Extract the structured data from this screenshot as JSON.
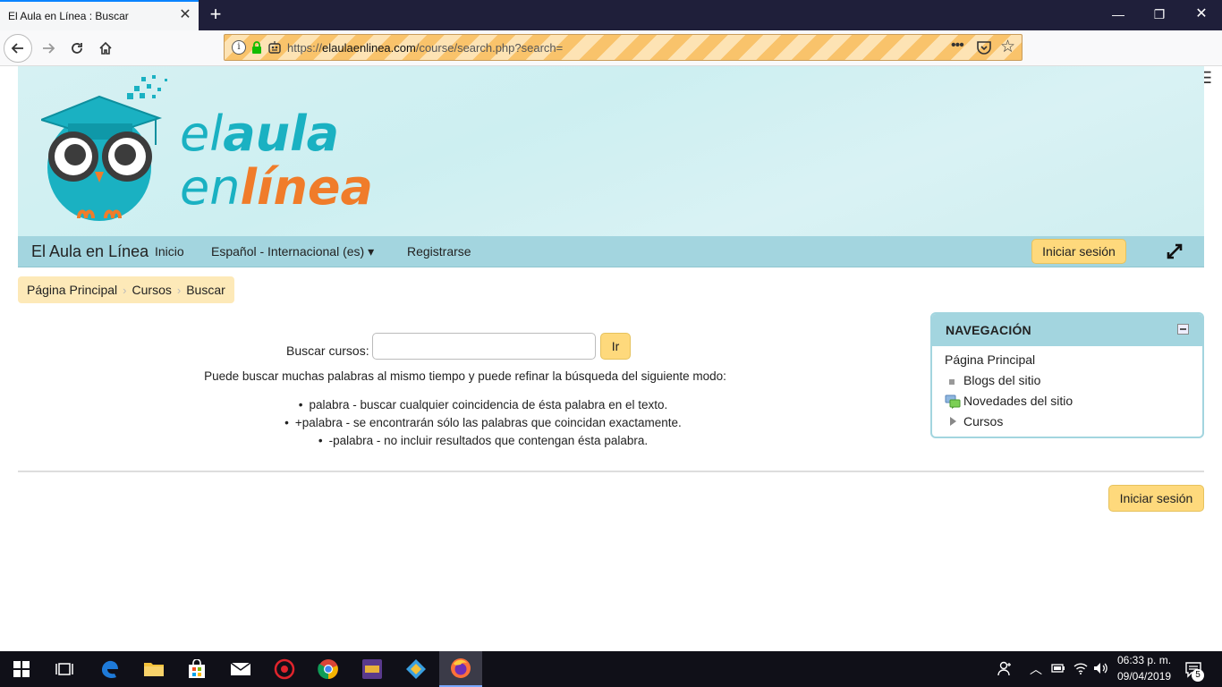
{
  "browser": {
    "tab_title": "El Aula en Línea : Buscar",
    "tab_close": "✕",
    "new_tab": "+",
    "url_scheme": "https://",
    "url_domain": "elaulaenlinea.com",
    "url_path": "/course/search.php?search=",
    "url_more": "•••",
    "win_min": "—",
    "win_max": "❐",
    "win_close": "✕",
    "menu": "☰",
    "accent": "#0a84ff"
  },
  "logo": {
    "line1_a": "el",
    "line1_b": "aula",
    "line2_a": "en",
    "line2_b": "línea",
    "teal": "#1ab1c2",
    "orange": "#f07c2a"
  },
  "site_nav": {
    "site_name": "El Aula en Línea",
    "home": "Inicio",
    "language": "Español - Internacional (es)",
    "register": "Registrarse",
    "login": "Iniciar sesión"
  },
  "breadcrumb": [
    "Página Principal",
    "Cursos",
    "Buscar"
  ],
  "search": {
    "label": "Buscar cursos:",
    "value": "",
    "button": "Ir",
    "help": "Puede buscar muchas palabras al mismo tiempo y puede refinar la búsqueda del siguiente modo:",
    "tips": [
      "palabra - buscar cualquier coincidencia de ésta palabra en el texto.",
      "+palabra - se encontrarán sólo las palabras que coincidan exactamente.",
      "-palabra - no incluir resultados que contengan ésta palabra."
    ]
  },
  "navigation_block": {
    "title": "NAVEGACIÓN",
    "items": [
      "Página Principal",
      "Blogs del sitio",
      "Novedades del sitio",
      "Cursos"
    ]
  },
  "footer": {
    "login": "Iniciar sesión"
  },
  "taskbar": {
    "time": "06:33 p. m.",
    "date": "09/04/2019",
    "notifications": "5"
  }
}
